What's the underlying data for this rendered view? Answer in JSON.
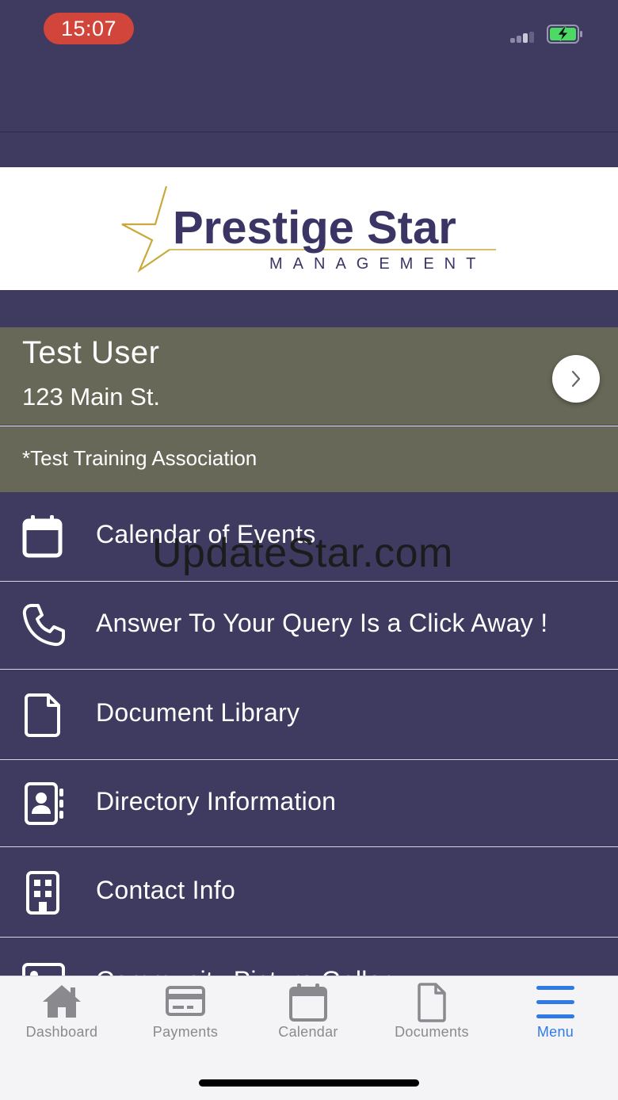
{
  "status_bar": {
    "time": "15:07",
    "signal_icon": "signal-icon",
    "battery_icon": "battery-charging-icon"
  },
  "logo": {
    "brand": "Prestige Star",
    "subtitle": "MANAGEMENT"
  },
  "user": {
    "name": "Test User",
    "address": "123 Main St.",
    "association": "*Test Training Association"
  },
  "menu": {
    "items": [
      {
        "label": "Calendar of Events",
        "icon": "calendar-icon"
      },
      {
        "label": "Answer To Your Query Is a Click Away !",
        "icon": "phone-icon"
      },
      {
        "label": "Document Library",
        "icon": "document-icon"
      },
      {
        "label": "Directory Information",
        "icon": "contact-card-icon"
      },
      {
        "label": "Contact Info",
        "icon": "building-icon"
      },
      {
        "label": "Community Picture Gallery",
        "icon": "image-icon"
      }
    ]
  },
  "watermark": "UpdateStar.com",
  "tab_bar": {
    "tabs": [
      {
        "label": "Dashboard",
        "icon": "home-icon"
      },
      {
        "label": "Payments",
        "icon": "credit-card-icon"
      },
      {
        "label": "Calendar",
        "icon": "calendar-icon"
      },
      {
        "label": "Documents",
        "icon": "document-icon"
      },
      {
        "label": "Menu",
        "icon": "hamburger-icon",
        "active": true
      }
    ]
  },
  "colors": {
    "header": "#3f3a60",
    "card": "#686858",
    "accent": "#2f7ae6",
    "recording_pill": "#d2453a",
    "logo_navy": "#3b3566",
    "logo_gold": "#c9a93a"
  }
}
